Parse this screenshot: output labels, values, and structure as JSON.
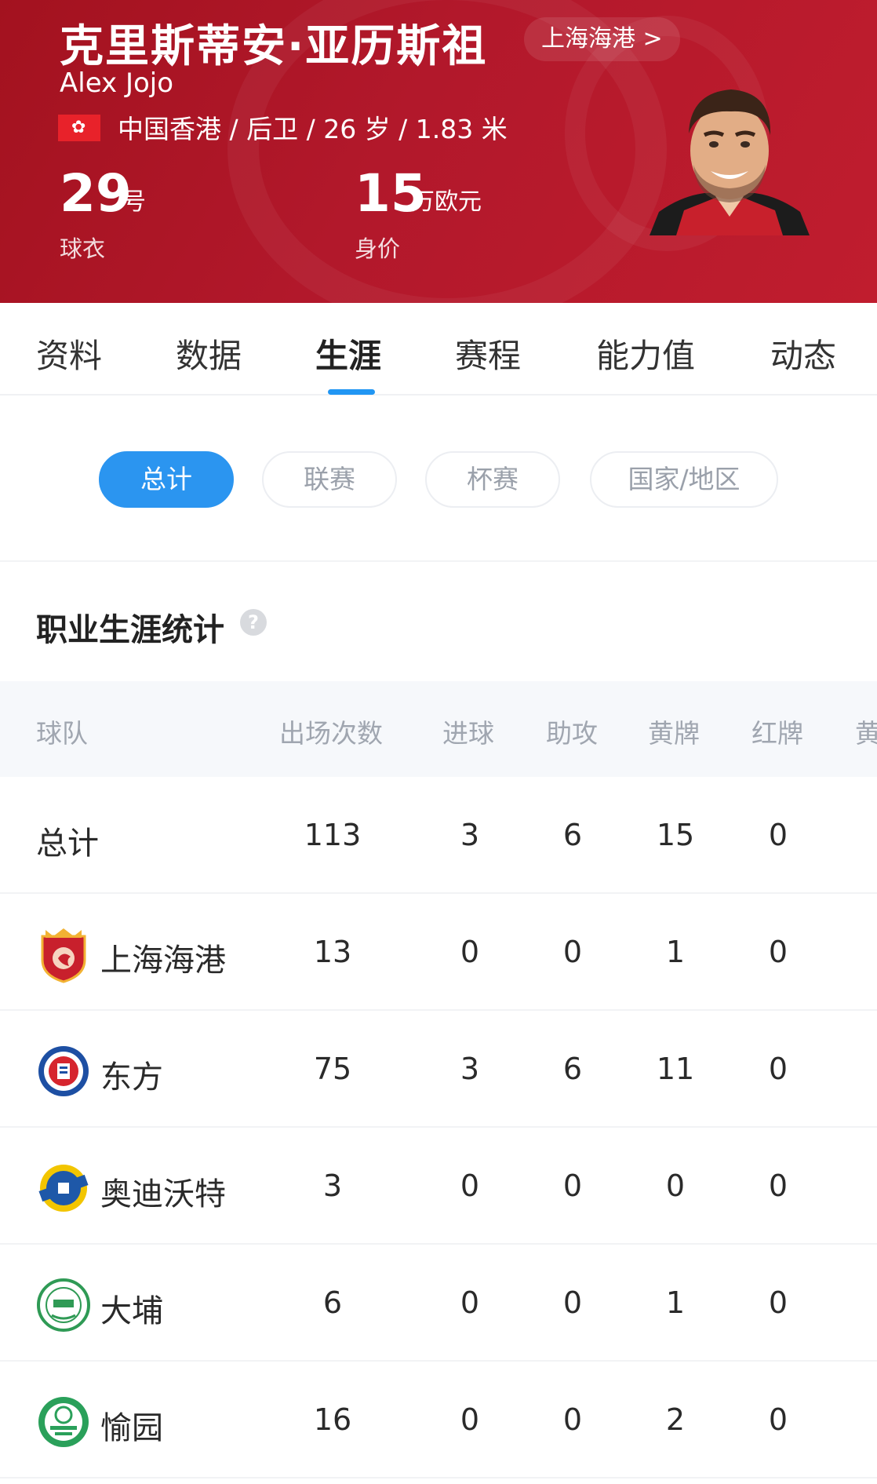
{
  "header": {
    "player_name": "克里斯蒂安·亚历斯祖",
    "english_name": "Alex Jojo",
    "club_link": "上海海港 >",
    "meta": "中国香港 / 后卫 / 26 岁 / 1.83 米",
    "shirt_number": "29",
    "shirt_unit": "号",
    "shirt_label": "球衣",
    "value_number": "15",
    "value_unit": "万欧元",
    "value_label": "身价",
    "colors": {
      "background": "#b2182b",
      "text": "#ffffff"
    }
  },
  "tabs": [
    "资料",
    "数据",
    "生涯",
    "赛程",
    "能力值",
    "动态"
  ],
  "active_tab": "生涯",
  "filters": [
    "总计",
    "联赛",
    "杯赛",
    "国家/地区"
  ],
  "active_filter": "总计",
  "section_title": "职业生涯统计",
  "table": {
    "columns": [
      "球队",
      "出场次数",
      "进球",
      "助攻",
      "黄牌",
      "红牌",
      "黄"
    ],
    "total_row": {
      "team": "总计",
      "apps": "113",
      "goals": "3",
      "assists": "6",
      "yellow": "15",
      "red": "0"
    },
    "rows": [
      {
        "team": "上海海港",
        "logo": "shanghai-port-logo",
        "apps": "13",
        "goals": "0",
        "assists": "0",
        "yellow": "1",
        "red": "0"
      },
      {
        "team": "东方",
        "logo": "eastern-logo",
        "apps": "75",
        "goals": "3",
        "assists": "6",
        "yellow": "11",
        "red": "0"
      },
      {
        "team": "奥迪沃特",
        "logo": "oddevold-logo",
        "apps": "3",
        "goals": "0",
        "assists": "0",
        "yellow": "0",
        "red": "0"
      },
      {
        "team": "大埔",
        "logo": "tai-po-logo",
        "apps": "6",
        "goals": "0",
        "assists": "0",
        "yellow": "1",
        "red": "0"
      },
      {
        "team": "愉园",
        "logo": "happy-valley-logo",
        "apps": "16",
        "goals": "0",
        "assists": "0",
        "yellow": "2",
        "red": "0"
      }
    ]
  },
  "accent_color": "#2b95f0"
}
